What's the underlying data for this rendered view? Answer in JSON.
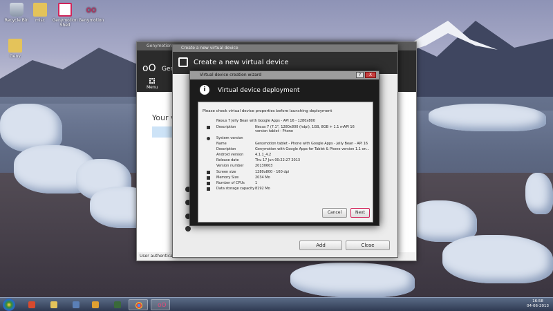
{
  "desktop": {
    "icons": [
      {
        "label": "Recycle Bin",
        "icon": "recycle-bin-icon"
      },
      {
        "label": "misc",
        "icon": "folder-icon"
      },
      {
        "label": "Genymotion Shell",
        "icon": "genymotion-shell-icon"
      },
      {
        "label": "Genymotion",
        "icon": "genymotion-icon"
      },
      {
        "label": "Geny",
        "icon": "folder-icon"
      }
    ]
  },
  "back_window": {
    "titlebar": "Genymotion",
    "app_name": "Gen",
    "menu_label": "Menu",
    "your_devices": "Your v",
    "footer": "User authentica"
  },
  "mid_window": {
    "titlebar": "Create a new virtual device",
    "title": "Create a new virtual device",
    "add_label": "Add",
    "close_label": "Close"
  },
  "dialog": {
    "titlebar": "Virtual device creation wizard",
    "help_label": "?",
    "close_label": "X",
    "title": "Virtual device deployment",
    "intro": "Please check virtual device properties before launching deployment",
    "properties": [
      {
        "key": "Nexus 7 Jelly Bean with Google Apps - API 16 - 1280x800",
        "value": ""
      },
      {
        "key": "Description",
        "value": "Nexus 7 (7.1\", 1280x800 (hdpi), 1GB, 8GB + 1.1 mAPI 16 version tablet - Phone"
      },
      {
        "key": "System version",
        "value": ""
      },
      {
        "key": "Name",
        "value": "Genymotion tablet - Phone with Google Apps - Jelly Bean - API 16"
      },
      {
        "key": "Description",
        "value": "Genymotion with Google Apps for Tablet & Phone version 1.1 on..."
      },
      {
        "key": "Android version",
        "value": "4.1.1_4.2"
      },
      {
        "key": "Release date",
        "value": "Thu 17 Jun 00:22:27 2013"
      },
      {
        "key": "Version number",
        "value": "20130603"
      },
      {
        "key": "Screen size",
        "value": "1280x800 - 160 dpi"
      },
      {
        "key": "Memory Size",
        "value": "2034 Mo"
      },
      {
        "key": "Number of CPUs",
        "value": "1"
      },
      {
        "key": "Data storage capacity",
        "value": "8192 Mo"
      }
    ],
    "cancel_label": "Cancel",
    "next_label": "Next"
  },
  "taskbar": {
    "clock_time": "16:58",
    "clock_date": "04-06-2013",
    "apps": [
      "start",
      "app-1",
      "explorer",
      "media",
      "terminal",
      "chrome",
      "genymotion"
    ]
  }
}
